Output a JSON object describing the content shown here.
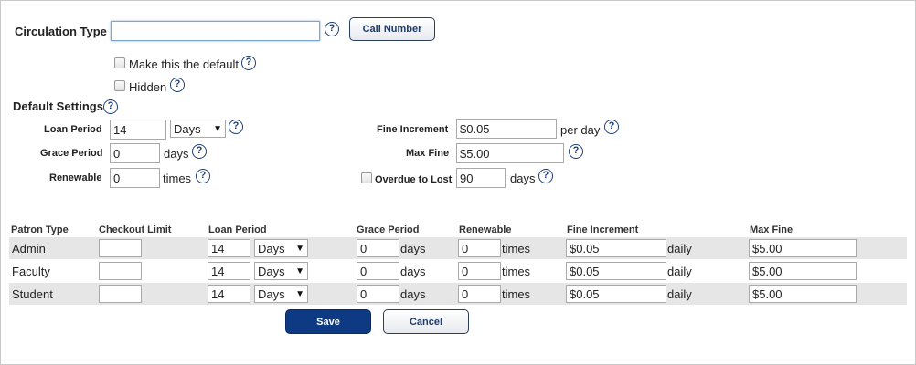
{
  "form": {
    "circulation_type_label": "Circulation Type",
    "circulation_type_value": "",
    "call_number_button": "Call Number",
    "make_default_label": "Make this the default",
    "hidden_label": "Hidden",
    "default_settings_label": "Default Settings",
    "help_glyph": "?",
    "loan_period_label": "Loan Period",
    "loan_period_value": "14",
    "loan_period_unit": "Days",
    "grace_period_label": "Grace Period",
    "grace_period_value": "0",
    "grace_period_unit": "days",
    "renewable_label": "Renewable",
    "renewable_value": "0",
    "renewable_unit": "times",
    "fine_increment_label": "Fine Increment",
    "fine_increment_value": "$0.05",
    "fine_increment_unit": "per day",
    "max_fine_label": "Max Fine",
    "max_fine_value": "$5.00",
    "overdue_to_lost_label": "Overdue to Lost",
    "overdue_to_lost_value": "90",
    "overdue_to_lost_unit": "days"
  },
  "table": {
    "headers": [
      "Patron Type",
      "Checkout Limit",
      "Loan Period",
      "Grace Period",
      "Renewable",
      "Fine Increment",
      "Max Fine"
    ],
    "units": {
      "grace": "days",
      "renewable": "times",
      "fine": "daily"
    },
    "rows": [
      {
        "patron_type": "Admin",
        "checkout_limit": "",
        "loan_period": "14",
        "loan_unit": "Days",
        "grace_period": "0",
        "renewable": "0",
        "fine_increment": "$0.05",
        "max_fine": "$5.00"
      },
      {
        "patron_type": "Faculty",
        "checkout_limit": "",
        "loan_period": "14",
        "loan_unit": "Days",
        "grace_period": "0",
        "renewable": "0",
        "fine_increment": "$0.05",
        "max_fine": "$5.00"
      },
      {
        "patron_type": "Student",
        "checkout_limit": "",
        "loan_period": "14",
        "loan_unit": "Days",
        "grace_period": "0",
        "renewable": "0",
        "fine_increment": "$0.05",
        "max_fine": "$5.00"
      }
    ]
  },
  "actions": {
    "save": "Save",
    "cancel": "Cancel"
  },
  "colors": {
    "primary": "#0e3a84",
    "help": "#1d3f77",
    "row_bg": "#e6e6e6"
  }
}
